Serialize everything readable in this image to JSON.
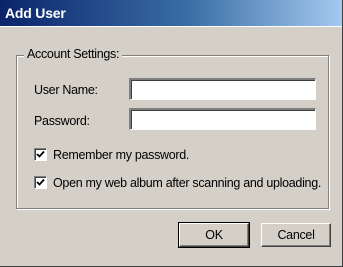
{
  "window": {
    "title": "Add User"
  },
  "account_settings": {
    "group_label": "Account Settings:",
    "user_name_label": "User Name:",
    "user_name_value": "",
    "password_label": "Password:",
    "password_value": "",
    "remember_password": {
      "label": "Remember my password.",
      "checked": true
    },
    "open_web_album": {
      "label": "Open my web album after scanning and uploading.",
      "checked": true
    }
  },
  "buttons": {
    "ok_label": "OK",
    "cancel_label": "Cancel"
  },
  "colors": {
    "title_bar_start": "#0a246a",
    "title_bar_end": "#a6caf0",
    "dialog_face": "#d4d0c8"
  }
}
